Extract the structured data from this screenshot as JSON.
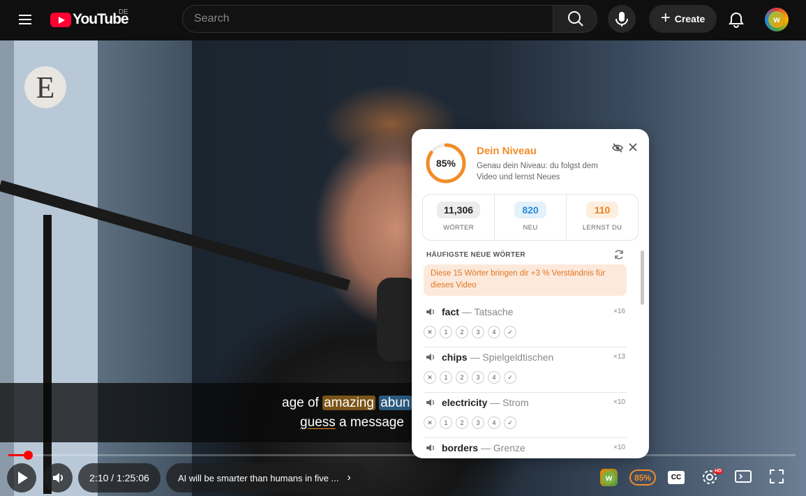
{
  "header": {
    "logo_text": "YouTube",
    "country_code": "DE",
    "search_placeholder": "Search",
    "create_label": "Create",
    "avatar_letter": "w"
  },
  "video": {
    "channel_logo_letter": "E",
    "subtitle": {
      "line1_pre": "age of ",
      "line1_hl1": "amazing",
      "line1_hl2": "abun",
      "line2_u": "guess",
      "line2_rest": " a message"
    },
    "progress_fraction": 0.0252
  },
  "controls": {
    "time": "2:10 / 1:25:06",
    "chapter": "AI will be smarter than humans in five ...",
    "ext_letter": "w",
    "ext_percent": "85%",
    "cc_label": "CC",
    "hd_badge": "HD"
  },
  "panel": {
    "percent_label": "85%",
    "percent_value": 0.85,
    "title": "Dein Niveau",
    "description": "Genau dein Niveau: du folgst dem Video und lernst Neues",
    "stats": [
      {
        "value": "11,306",
        "label": "WÖRTER"
      },
      {
        "value": "820",
        "label": "NEU"
      },
      {
        "value": "110",
        "label": "LERNST DU"
      }
    ],
    "section_heading": "HÄUFIGSTE NEUE WÖRTER",
    "tip": "Diese 15 Wörter bringen dir +3 % Verständnis für dieses Video",
    "words": [
      {
        "term": "fact",
        "dash": " — ",
        "translation": "Tatsache",
        "count": "×16"
      },
      {
        "term": "chips",
        "dash": " — ",
        "translation": "Spielgeldtischen",
        "count": "×13"
      },
      {
        "term": "electricity",
        "dash": " — ",
        "translation": "Strom",
        "count": "×10"
      },
      {
        "term": "borders",
        "dash": " — ",
        "translation": "Grenze",
        "count": "×10"
      }
    ],
    "level_buttons": [
      "✕",
      "1",
      "2",
      "3",
      "4",
      "✓"
    ]
  },
  "colors": {
    "accent_orange": "#f28c28",
    "youtube_red": "#ff0033",
    "new_blue": "#2a8ad4"
  }
}
